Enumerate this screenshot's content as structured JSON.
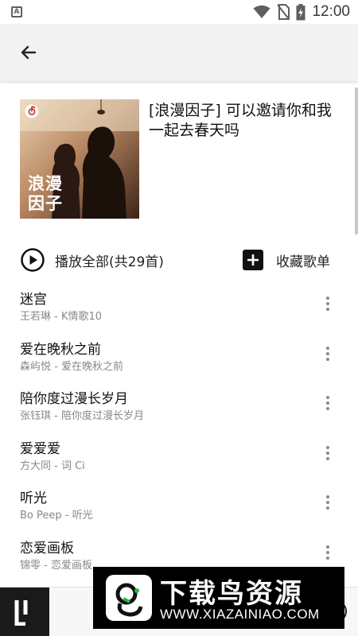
{
  "status_bar": {
    "left_icon_letter": "A",
    "time": "12:00",
    "icons": [
      "wifi-icon",
      "no-sim-icon",
      "battery-charging-icon"
    ]
  },
  "app_bar": {
    "back_icon": "arrow-left-icon"
  },
  "playlist": {
    "title": "[浪漫因子] 可以邀请你和我一起去春天吗",
    "cover_text_line1": "浪漫",
    "cover_text_line2": "因子",
    "cover_badge_icon": "netease-music-icon"
  },
  "actions": {
    "play_all_label": "播放全部(共29首)",
    "play_all_icon": "play-circle-icon",
    "collect_label": "收藏歌单",
    "collect_icon": "add-box-icon"
  },
  "songs": [
    {
      "title": "迷宫",
      "subtitle": "王若琳 - K情歌10"
    },
    {
      "title": "爱在晚秋之前",
      "subtitle": "森屿悦 - 爱在晚秋之前"
    },
    {
      "title": "陪你度过漫长岁月",
      "subtitle": "张钰琪 - 陪你度过漫长岁月"
    },
    {
      "title": "爱爱爱",
      "subtitle": "方大同 - 词 Ci"
    },
    {
      "title": "听光",
      "subtitle": "Bo Peep - 听光"
    },
    {
      "title": "恋爱画板",
      "subtitle": "锦零 - 恋爱画板"
    }
  ],
  "watermark": {
    "title": "下载鸟资源",
    "url": "WWW.XIAZAINIAO.COM"
  },
  "colors": {
    "app_bar_bg": "#f2f2f2",
    "cover_bg": "#5a3a28",
    "subtitle": "#888888"
  }
}
